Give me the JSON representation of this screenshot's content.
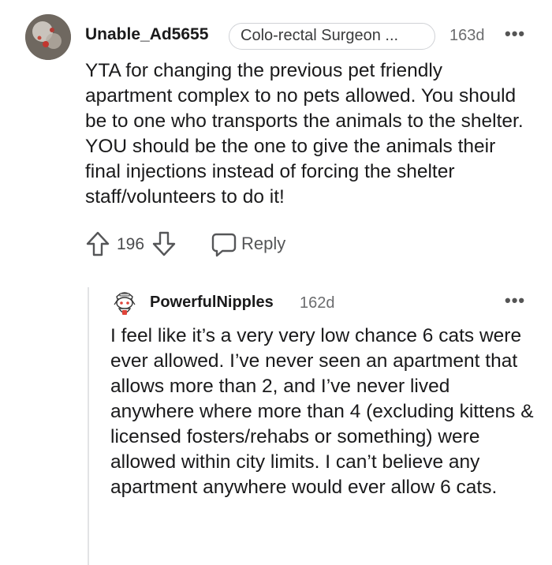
{
  "comment": {
    "username": "Unable_Ad5655",
    "flair": "Colo-rectal Surgeon ...",
    "time": "163d",
    "more": "•••",
    "body": "YTA for changing the previous pet friendly apartment complex to no pets allowed. You should be to one who transports the animals to the shelter. YOU should be the one to give the animals their final injections instead of forcing the shelter staff/volunteers to do it!",
    "votes": "196",
    "reply_label": "Reply"
  },
  "reply": {
    "username": "PowerfulNipples",
    "time": "162d",
    "more": "•••",
    "body": "I feel like it’s a very very low chance 6 cats were ever allowed. I’ve never seen an apartment that allows more than 2, and I’ve never lived anywhere where more than 4 (excluding kittens & licensed fosters/rehabs or something) were allowed within city limits. I can’t believe any apartment anywhere would ever allow 6 cats."
  },
  "icons": {
    "upvote": "arrow-up-outline",
    "downvote": "arrow-down-outline",
    "reply": "speech-bubble-outline",
    "more": "ellipsis-horizontal"
  }
}
